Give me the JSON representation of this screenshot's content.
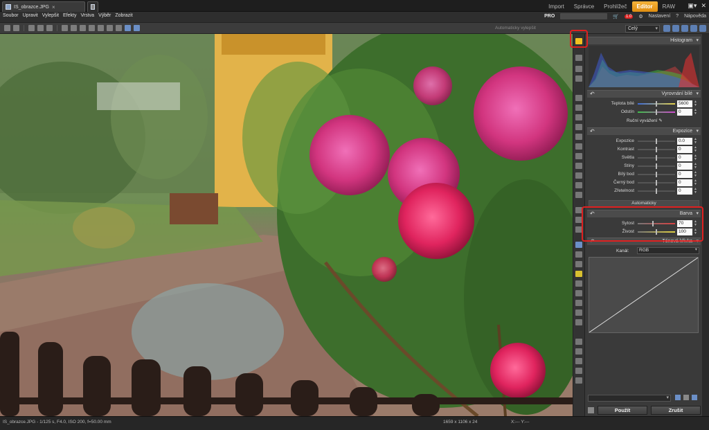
{
  "app": {
    "doc_tab": "IS_obrazce.JPG",
    "modes": [
      "Import",
      "Správce",
      "Prohlížeč",
      "Editor",
      "RAW"
    ],
    "active_mode": "Editor"
  },
  "menu": {
    "items": [
      "Soubor",
      "Upravit",
      "Vylepšit",
      "Efekty",
      "Vrstva",
      "Výběr",
      "Zobrazit"
    ],
    "pro_label": "PRO",
    "cart_badge": "1.0",
    "settings_label": "Nastavení",
    "help_label": "Nápověda"
  },
  "toolbar": {
    "auto_enhance_label": "Automaticky vylepšit",
    "zoom_value": "Celý"
  },
  "panel": {
    "histogram_title": "Histogram",
    "white_balance": {
      "title": "Vyrovnání bílé",
      "rows": [
        {
          "label": "Teplota bílé",
          "value": "5600",
          "track": "linear-gradient(90deg,#3d6bd8,#e8d44a)",
          "pos": 0.5
        },
        {
          "label": "Odstín",
          "value": "0",
          "track": "linear-gradient(90deg,#3fbf4a,#d04ad0)",
          "pos": 0.5
        }
      ],
      "manual_label": "Ruční vyvážení"
    },
    "exposure": {
      "title": "Expozice",
      "rows": [
        {
          "label": "Expozice",
          "value": "0.0",
          "pos": 0.5
        },
        {
          "label": "Kontrast",
          "value": "0",
          "pos": 0.5
        },
        {
          "label": "Světla",
          "value": "0",
          "pos": 0.5
        },
        {
          "label": "Stíny",
          "value": "0",
          "pos": 0.5
        },
        {
          "label": "Bílý bod",
          "value": "0",
          "pos": 0.5
        },
        {
          "label": "Černý bod",
          "value": "0",
          "pos": 0.5
        },
        {
          "label": "Zřetelnost",
          "value": "0",
          "pos": 0.5
        }
      ],
      "auto_label": "Automaticky"
    },
    "color": {
      "title": "Barva",
      "rows": [
        {
          "label": "Sytost",
          "value": "70",
          "track": "linear-gradient(90deg,#777,#d84040)",
          "pos": 0.4
        },
        {
          "label": "Živost",
          "value": "100",
          "track": "linear-gradient(90deg,#777,#e0d040)",
          "pos": 0.5
        }
      ]
    },
    "tone_curve": {
      "title": "Tónová křivka",
      "channel_label": "Kanál:",
      "channel_value": "RGB"
    },
    "apply_label": "Použít",
    "cancel_label": "Zrušit"
  },
  "status": {
    "file_info": "IS_obrazce.JPG - 1/125 s, F4.0, ISO 200, f=50.00 mm",
    "dimensions": "1659 x 1106 x 24",
    "coords": "X:---  Y:---"
  },
  "colors": {
    "accent": "#f0a020",
    "highlight_box": "#e02020"
  }
}
